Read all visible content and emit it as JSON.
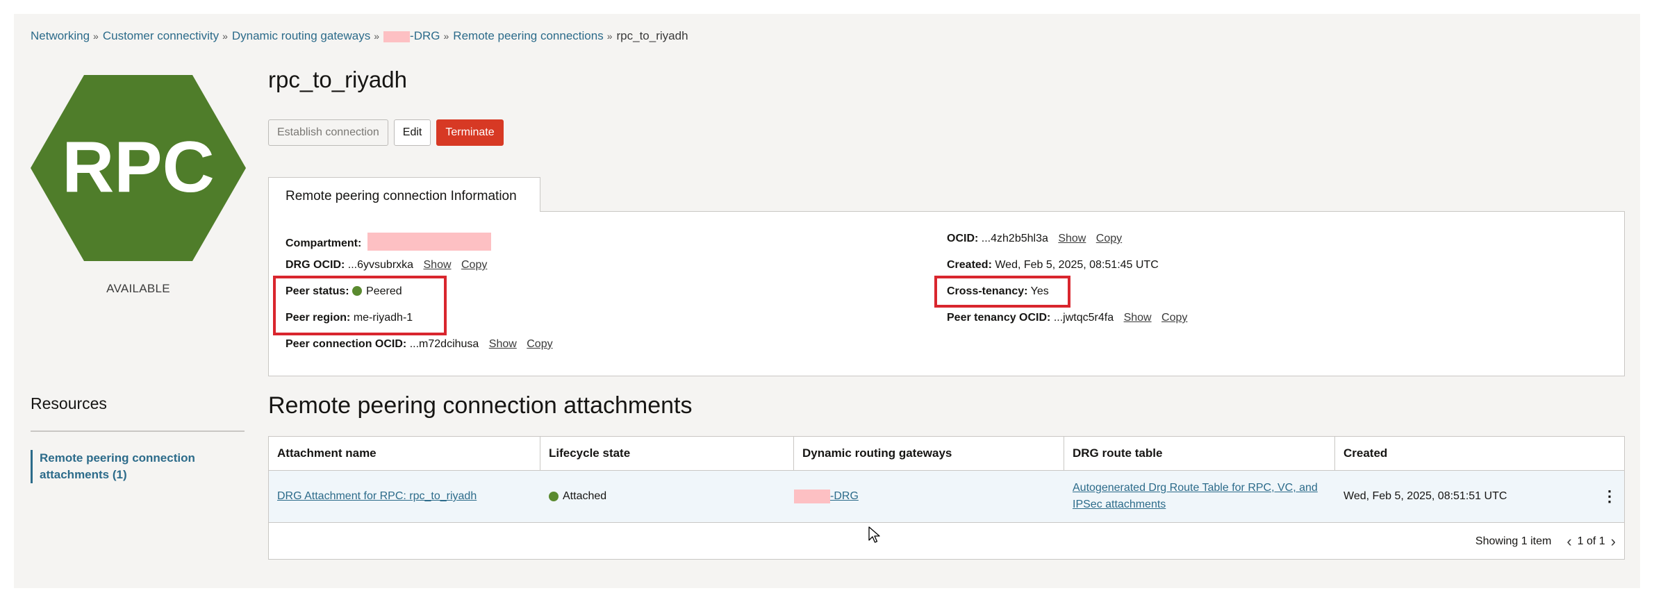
{
  "breadcrumb": {
    "items": [
      "Networking",
      "Customer connectivity",
      "Dynamic routing gateways"
    ],
    "drg_suffix": "-DRG",
    "rpc_list": "Remote peering connections",
    "current": "rpc_to_riyadh",
    "separator": "»"
  },
  "logo": {
    "text": "RPC",
    "color": "#4f7d2a",
    "status": "AVAILABLE"
  },
  "title": "rpc_to_riyadh",
  "actions": {
    "establish": "Establish connection",
    "edit": "Edit",
    "terminate": "Terminate"
  },
  "info": {
    "tab_label": "Remote peering connection Information",
    "compartment_label": "Compartment:",
    "drg_ocid_label": "DRG OCID:",
    "drg_ocid_value": "...6yvsubrxka",
    "peer_status_label": "Peer status:",
    "peer_status_value": "Peered",
    "peer_region_label": "Peer region:",
    "peer_region_value": "me-riyadh-1",
    "peer_conn_ocid_label": "Peer connection OCID:",
    "peer_conn_ocid_value": "...m72dcihusa",
    "ocid_label": "OCID:",
    "ocid_value": "...4zh2b5hl3a",
    "created_label": "Created:",
    "created_value": "Wed, Feb 5, 2025, 08:51:45 UTC",
    "cross_tenancy_label": "Cross-tenancy:",
    "cross_tenancy_value": "Yes",
    "peer_tenancy_label": "Peer tenancy OCID:",
    "peer_tenancy_value": "...jwtqc5r4fa",
    "show": "Show",
    "copy": "Copy"
  },
  "resources": {
    "title": "Resources",
    "item": "Remote peering connection attachments (1)"
  },
  "attachments": {
    "title": "Remote peering connection attachments",
    "columns": [
      "Attachment name",
      "Lifecycle state",
      "Dynamic routing gateways",
      "DRG route table",
      "Created"
    ],
    "rows": [
      {
        "name": "DRG Attachment for RPC: rpc_to_riyadh",
        "state": "Attached",
        "drg": "-DRG",
        "route_table": "Autogenerated Drg Route Table for RPC, VC, and IPSec attachments",
        "created": "Wed, Feb 5, 2025, 08:51:51 UTC"
      }
    ],
    "kebab": "⋮",
    "showing": "Showing 1 item",
    "page": "1 of 1",
    "prev": "‹",
    "next": "›"
  }
}
